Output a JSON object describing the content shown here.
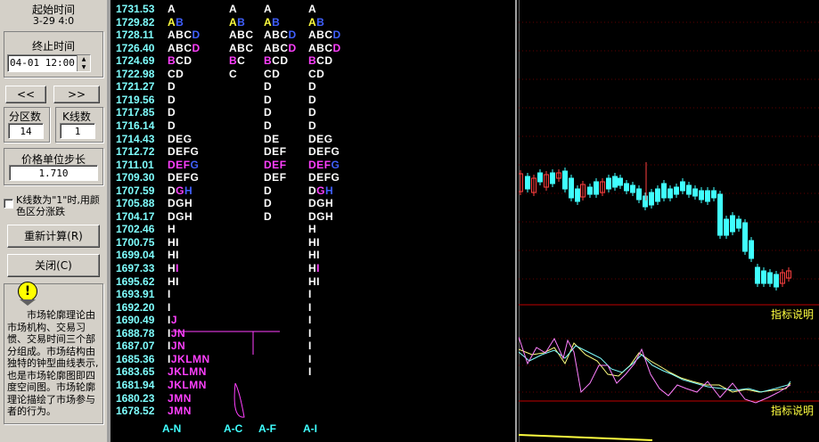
{
  "sidebar": {
    "start_label": "起始时间",
    "start_value": "3-29 4:0",
    "end_label": "终止时间",
    "end_value": "04-01 12:00",
    "prev_btn": "<<",
    "next_btn": ">>",
    "partition_label": "分区数",
    "partition_value": "14",
    "kline_label": "K线数",
    "kline_value": "1",
    "step_label": "价格单位步长",
    "step_value": "1.710",
    "checkbox_text": "K线数为\"1\"时,用颜色区分涨跌",
    "recalc_btn": "重新计算(R)",
    "close_btn": "关闭(C)",
    "help_text": "市场轮廓理论由市场机构、交易习惯、交易时间三个部分组成。市场结构由独特的钟型曲线表示,也是市场轮廓图即四度空间图。市场轮廓理论描绘了市场参与者的行为。"
  },
  "profile": {
    "rows": [
      {
        "p": "1731.53",
        "c1": "A",
        "c2": "A",
        "c3": "A",
        "c4": "A"
      },
      {
        "p": "1729.82",
        "c1": "AB",
        "c2": "AB",
        "c3": "AB",
        "c4": "AB"
      },
      {
        "p": "1728.11",
        "c1": "ABCD",
        "c2": "ABC",
        "c3": "ABCD",
        "c4": "ABCD"
      },
      {
        "p": "1726.40",
        "c1": "ABCD",
        "c2": "ABC",
        "c3": "ABCD",
        "c4": "ABCD"
      },
      {
        "p": "1724.69",
        "c1": "BCD",
        "c2": "BC",
        "c3": "BCD",
        "c4": "BCD"
      },
      {
        "p": "1722.98",
        "c1": "CD",
        "c2": "C",
        "c3": "CD",
        "c4": "CD"
      },
      {
        "p": "1721.27",
        "c1": "D",
        "c2": "",
        "c3": "D",
        "c4": "D"
      },
      {
        "p": "1719.56",
        "c1": "D",
        "c2": "",
        "c3": "D",
        "c4": "D"
      },
      {
        "p": "1717.85",
        "c1": "D",
        "c2": "",
        "c3": "D",
        "c4": "D"
      },
      {
        "p": "1716.14",
        "c1": "D",
        "c2": "",
        "c3": "D",
        "c4": "D"
      },
      {
        "p": "1714.43",
        "c1": "DEG",
        "c2": "",
        "c3": "DE",
        "c4": "DEG"
      },
      {
        "p": "1712.72",
        "c1": "DEFG",
        "c2": "",
        "c3": "DEF",
        "c4": "DEFG"
      },
      {
        "p": "1711.01",
        "c1": "DEFG",
        "c2": "",
        "c3": "DEF",
        "c4": "DEFG"
      },
      {
        "p": "1709.30",
        "c1": "DEFG",
        "c2": "",
        "c3": "DEF",
        "c4": "DEFG"
      },
      {
        "p": "1707.59",
        "c1": "DGH",
        "c2": "",
        "c3": "D",
        "c4": "DGH"
      },
      {
        "p": "1705.88",
        "c1": "DGH",
        "c2": "",
        "c3": "D",
        "c4": "DGH"
      },
      {
        "p": "1704.17",
        "c1": "DGH",
        "c2": "",
        "c3": "D",
        "c4": "DGH"
      },
      {
        "p": "1702.46",
        "c1": "H",
        "c2": "",
        "c3": "",
        "c4": "H"
      },
      {
        "p": "1700.75",
        "c1": "HI",
        "c2": "",
        "c3": "",
        "c4": "HI"
      },
      {
        "p": "1699.04",
        "c1": "HI",
        "c2": "",
        "c3": "",
        "c4": "HI"
      },
      {
        "p": "1697.33",
        "c1": "HI",
        "c2": "",
        "c3": "",
        "c4": "HI"
      },
      {
        "p": "1695.62",
        "c1": "HI",
        "c2": "",
        "c3": "",
        "c4": "HI"
      },
      {
        "p": "1693.91",
        "c1": "I",
        "c2": "",
        "c3": "",
        "c4": "I"
      },
      {
        "p": "1692.20",
        "c1": "I",
        "c2": "",
        "c3": "",
        "c4": "I"
      },
      {
        "p": "1690.49",
        "c1": "IJ",
        "c2": "",
        "c3": "",
        "c4": "I"
      },
      {
        "p": "1688.78",
        "c1": "IJN",
        "c2": "",
        "c3": "",
        "c4": "I"
      },
      {
        "p": "1687.07",
        "c1": "IJN",
        "c2": "",
        "c3": "",
        "c4": "I"
      },
      {
        "p": "1685.36",
        "c1": "IJKLMN",
        "c2": "",
        "c3": "",
        "c4": "I"
      },
      {
        "p": "1683.65",
        "c1": "JKLMN",
        "c2": "",
        "c3": "",
        "c4": "I"
      },
      {
        "p": "1681.94",
        "c1": "JKLMN",
        "c2": "",
        "c3": "",
        "c4": ""
      },
      {
        "p": "1680.23",
        "c1": "JMN",
        "c2": "",
        "c3": "",
        "c4": ""
      },
      {
        "p": "1678.52",
        "c1": "JMN",
        "c2": "",
        "c3": "",
        "c4": ""
      }
    ],
    "footer": [
      "A-N",
      "A-C",
      "A-F",
      "A-I"
    ]
  },
  "chart": {
    "indicator_label_1": "指标说明",
    "indicator_label_2": "指标说明"
  },
  "colors": {
    "price": "#7fffff",
    "letters": "#ffffff",
    "yellow": "#ffff40",
    "blue": "#4060ff",
    "magenta": "#ff40ff",
    "grid_red": "#c00000"
  }
}
